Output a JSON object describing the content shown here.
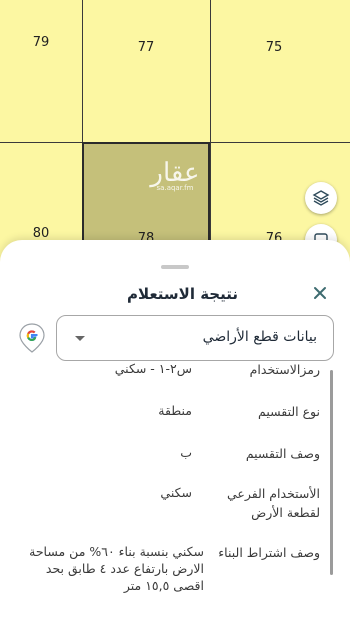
{
  "map": {
    "parcels": [
      {
        "id": "79",
        "label": "79"
      },
      {
        "id": "77",
        "label": "77"
      },
      {
        "id": "75",
        "label": "75"
      },
      {
        "id": "80",
        "label": "80"
      },
      {
        "id": "78",
        "label": "78"
      },
      {
        "id": "76",
        "label": "76"
      }
    ],
    "watermark": {
      "brand": "عقار",
      "site": "sa.aqar.fm"
    },
    "layers_icon": "layers-icon"
  },
  "sheet": {
    "title": "نتيجة الاستعلام",
    "close_icon": "close-icon",
    "google_icon": "google-maps-icon",
    "select_value": "بيانات قطع الأراضي"
  },
  "details": [
    {
      "label": "رمزالاستخدام",
      "value": "س٢-١ - سكني"
    },
    {
      "label": "نوع التقسيم",
      "value": "منطقة"
    },
    {
      "label": "وصف التقسيم",
      "value": "ب"
    },
    {
      "label": "الأستخدام الفرعي لقطعة الأرض",
      "value": "سكني"
    },
    {
      "label": "وصف اشتراط البناء",
      "value": "سكني بنسبة بناء ٦٠% من مساحة الارض بارتفاع عدد ٤ طابق بحد اقصى ١٥,٥ متر"
    }
  ],
  "colors": {
    "parcel": "#fcf7a2",
    "selected_parcel": "#c5c07a",
    "accent": "#1f2a37"
  }
}
